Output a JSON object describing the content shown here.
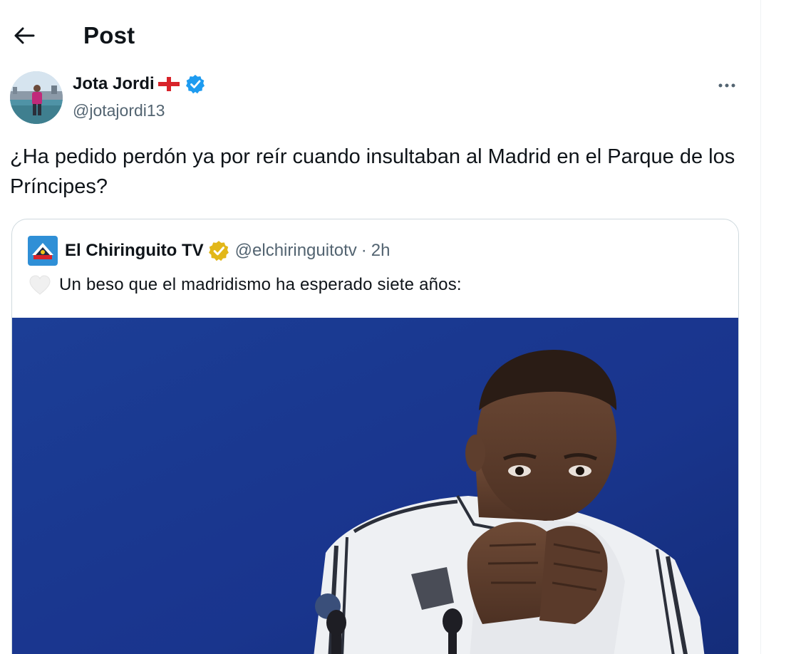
{
  "header": {
    "title": "Post",
    "back_icon": "arrow-left-icon"
  },
  "tweet": {
    "display_name": "Jota Jordi",
    "flag_icon": "england-flag-icon",
    "verified_color": "#1d9bf0",
    "handle": "@jotajordi13",
    "more_icon": "more-horizontal-icon",
    "text": "¿Ha pedido perdón ya por reír cuando insultaban al Madrid en el Parque de los Príncipes?"
  },
  "quote": {
    "display_name": "El Chiringuito TV",
    "badge_color": "#e2b719",
    "handle": "@elchiringuitotv",
    "separator": "·",
    "time": "2h",
    "emoji_icon": "white-heart-icon",
    "text": "Un beso que el madridismo ha esperado siete años:",
    "media_icon": "photo-player-kissing-jersey"
  },
  "colors": {
    "text": "#0f1419",
    "secondary_text": "#536471",
    "border": "#cfd9de",
    "media_background": "#1b3a8c"
  }
}
